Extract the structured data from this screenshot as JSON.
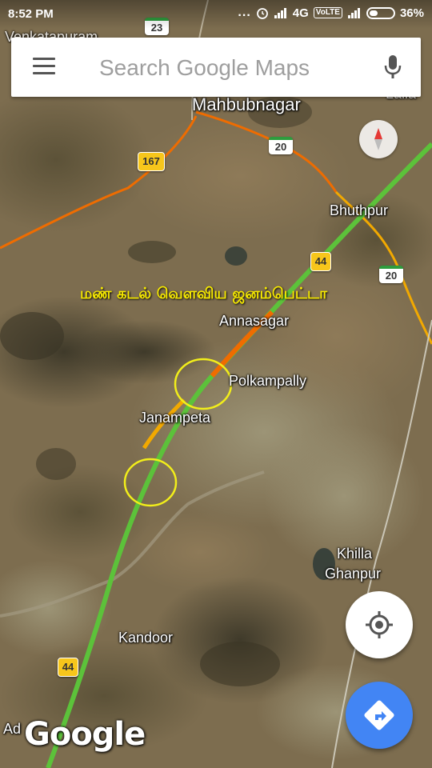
{
  "status_bar": {
    "time": "8:52 PM",
    "dots": "...",
    "network": "4G",
    "volte": "VoLTE",
    "battery": "36%",
    "battery_level": 0.36
  },
  "search": {
    "placeholder": "Search Google Maps",
    "value": ""
  },
  "map": {
    "places": {
      "venkatapuram": "Venkatapuram",
      "mahbubnagar": "Mahbubnagar",
      "bhuthpur": "Bhuthpur",
      "annasagar": "Annasagar",
      "polkampally": "Polkampally",
      "janampeta": "Janampeta",
      "khilla": "Khilla",
      "ghanpur": "Ghanpur",
      "kandoor": "Kandoor",
      "lalla": "Lalla",
      "ad": "Ad"
    },
    "road_shields": {
      "nh23": "23",
      "nh167": "167",
      "sh20_top": "20",
      "nh44_top": "44",
      "sh20_right": "20",
      "nh44_bottom": "44"
    },
    "annotation_text": "மண் கடல் வெளவிய ஜனம்பெட்டா",
    "annotation_color": "#f7ea00",
    "highlight_circle_color": "#f2ee1a",
    "highway_color": "#5cc23a",
    "traffic_colors": [
      "#ef6c00",
      "#f2a900"
    ]
  },
  "controls": {
    "compass_icon": "compass-icon",
    "location_icon": "my-location-icon",
    "directions_icon": "directions-icon",
    "accent": "#4285f4"
  },
  "branding": {
    "logo": "Google"
  }
}
